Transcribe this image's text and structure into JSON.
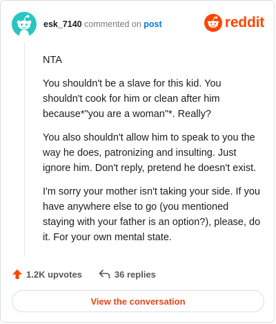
{
  "header": {
    "username": "esk_7140",
    "action_text": "commented on",
    "post_link": "post",
    "brand_name": "reddit",
    "avatar_icon": "reddit-snoo-avatar-icon",
    "brand_icon": "reddit-logo-icon"
  },
  "comment": {
    "paragraphs": [
      "NTA",
      "You shouldn't be a slave for this kid. You shouldn't cook for him or clean after him because*\"you are a woman\"*. Really?",
      "You also shouldn't allow him to speak to you the way he does, patronizing and insulting. Just ignore him. Don't reply, pretend he doesn't exist.",
      "I'm sorry your mother isn't taking your side. If you have anywhere else to go (you mentioned staying with your father is an option?), please, do it. For your own mental state."
    ]
  },
  "footer": {
    "upvotes_label": "1.2K upvotes",
    "replies_label": "36 replies",
    "upvote_icon": "upvote-arrow-icon",
    "reply_icon": "reply-arrow-icon"
  },
  "button": {
    "conversation_label": "View the conversation"
  },
  "colors": {
    "brand": "#ff4500",
    "link_blue": "#0079d3",
    "avatar_teal": "#2bc5c1",
    "button_text": "#e0461a"
  }
}
